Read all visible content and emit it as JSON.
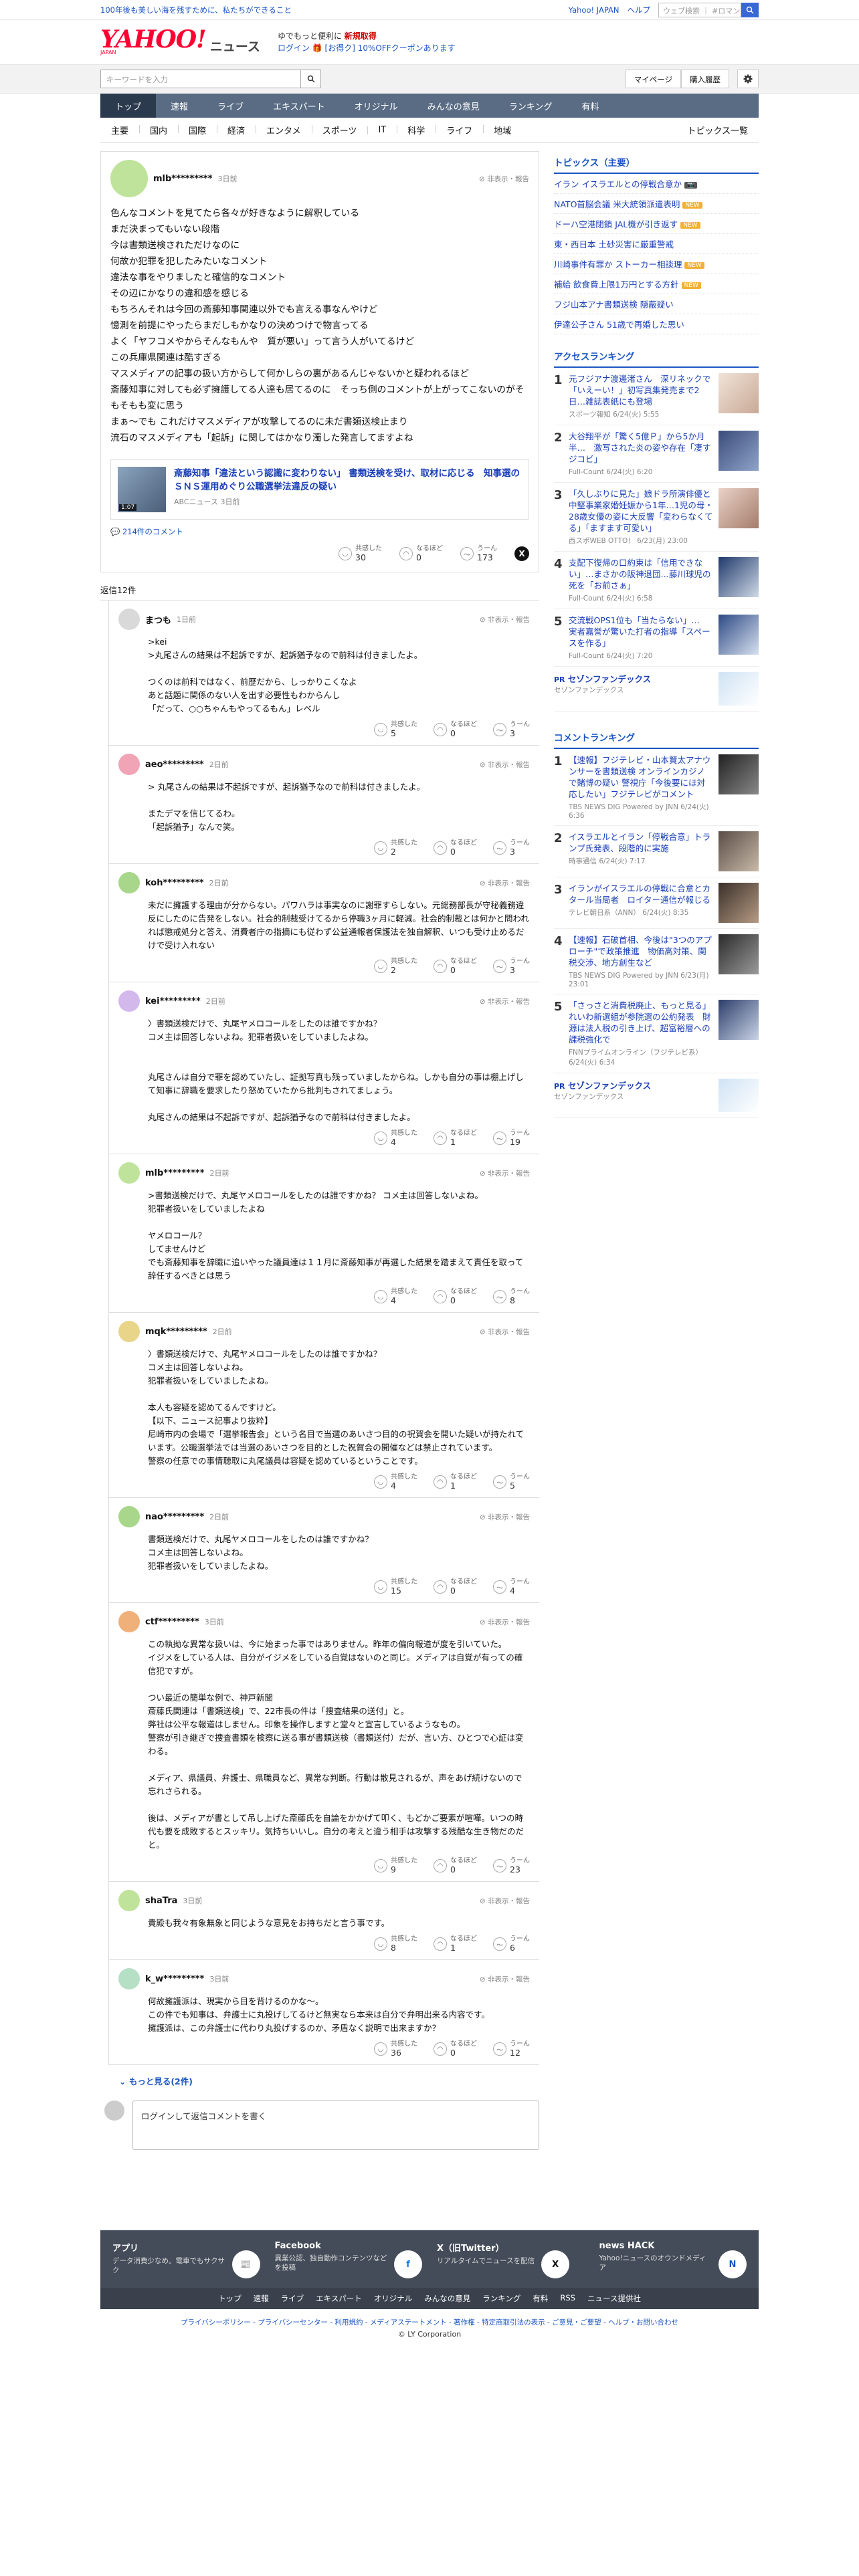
{
  "topstrip": {
    "left": "100年後も美しい海を残すために、私たちができること",
    "yahoo_japan": "Yahoo! JAPAN",
    "help": "ヘルプ",
    "search_placeholder": "ウェブ検索",
    "search_query": "#ロマンティック..."
  },
  "brand": {
    "logo": "YAHOO!",
    "logo_sub": "JAPAN",
    "news": "ニュース",
    "promo1": "ゆでもっと便利に",
    "promo1b": "新規取得",
    "promo2": "ログイン 🎁 [お得ク] 10%OFFクーポンあります"
  },
  "searchbar": {
    "placeholder": "キーワードを入力",
    "mypage": "マイページ",
    "history": "購入履歴"
  },
  "gnav": [
    "トップ",
    "速報",
    "ライブ",
    "エキスパート",
    "オリジナル",
    "みんなの意見",
    "ランキング",
    "有料"
  ],
  "snav": [
    "主要",
    "国内",
    "国際",
    "経済",
    "エンタメ",
    "スポーツ",
    "IT",
    "科学",
    "ライフ",
    "地域"
  ],
  "snav_right": "トピックス一覧",
  "post": {
    "user": "mlb*********",
    "time": "3日前",
    "report": "非表示・報告",
    "text": "色んなコメントを見てたら各々が好きなように解釈している\nまだ決まってもいない段階\n今は書類送検されただけなのに\n何故か犯罪を犯したみたいなコメント\n違法な事をやりましたと確信的なコメント\nその辺にかなりの違和感を感じる\nもちろんそれは今回の斎藤知事関連以外でも言える事なんやけど\n憶測を前提にやったらまだしもかなりの決めつけで物言ってる\nよく「ヤフコメやからそんなもんや　質が悪い」って言う人がいてるけど\nこの兵庫県関連は酷すぎる\nマスメディアの記事の扱い方からして何かしらの裏があるんじゃないかと疑われるほど\n斎藤知事に対しても必ず擁護してる人達も居てるのに　そっち側のコメントが上がってこないのがそもそもも変に思う\nまぁ〜でも これだけマスメディアが攻撃してるのに未だ書類送検止まり\n流石のマスメディアも「起訴」に関してはかなり濁した発言してますよね",
    "article_title": "斎藤知事「違法という認識に変わりない」 書類送検を受け、取材に応じる　知事選のＳＮＳ運用めぐり公職選挙法違反の疑い",
    "article_source": "ABCニュース 3日前",
    "article_duration": "1:07",
    "comment_count": "214件のコメント",
    "reactions": {
      "agree_label": "共感した",
      "agree": "30",
      "naruhodo_label": "なるほど",
      "naruhodo": "0",
      "uun_label": "うーん",
      "uun": "173"
    }
  },
  "reply_header": "返信12件",
  "replies": [
    {
      "user": "まつも",
      "time": "1日前",
      "text": ">kei\n>丸尾さんの結果は不起訴ですが、起訴猶予なので前科は付きましたよ。\n\nつくのは前科ではなく、前歴だから、しっかりこくなよ\nあと話題に関係のない人を出す必要性もわからんし\n「だって、○○ちゃんもやってるもん」レベル",
      "agree": "5",
      "naruhodo": "0",
      "uun": "3",
      "color": "#d9d9d9"
    },
    {
      "user": "aeo*********",
      "time": "2日前",
      "text": "> 丸尾さんの結果は不起訴ですが、起訴猶予なので前科は付きましたよ。\n\nまたデマを信じてるわ。\n「起訴猶予」なんで笑。",
      "agree": "2",
      "naruhodo": "0",
      "uun": "3",
      "color": "#f0a4b5"
    },
    {
      "user": "koh*********",
      "time": "2日前",
      "text": "未だに擁護する理由が分からない。パワハラは事実なのに謝罪すらしない。元総務部長が守秘義務違反にしたのに告発をしない。社会的制裁受けてるから停職3ヶ月に軽減。社会的制裁とは何かと問われれば懲戒処分と答え、消費者庁の指摘にも従わず公益通報者保護法を独自解釈、いつも受け止めるだけで受け入れない",
      "agree": "2",
      "naruhodo": "0",
      "uun": "3",
      "color": "#a8d68a"
    },
    {
      "user": "kei*********",
      "time": "2日前",
      "text": "〉書類送検だけで、丸尾ヤメロコールをしたのは誰ですかね？\nコメ主は回答しないよね。犯罪者扱いをしていましたよね。\n\n\n丸尾さんは自分で罪を認めていたし、証拠写真も残っていましたからね。しかも自分の事は棚上げして知事に辞職を要求したり怒めていたから批判もされてましょう。\n\n丸尾さんの結果は不起訴ですが、起訴猶予なので前科は付きましたよ。",
      "agree": "4",
      "naruhodo": "1",
      "uun": "19",
      "color": "#d3b8ec"
    },
    {
      "user": "mlb*********",
      "time": "2日前",
      "text": ">書類送検だけで、丸尾ヤメロコールをしたのは誰ですかね？ コメ主は回答しないよね。\n犯罪者扱いをしていましたよね\n\nヤメロコール？\nしてませんけど\nでも斎藤知事を辞職に追いやった議員達は１１月に斎藤知事が再選した結果を踏まえて責任を取って辞任するべきとは思う",
      "agree": "4",
      "naruhodo": "0",
      "uun": "8",
      "color": "#bfe39b"
    },
    {
      "user": "mqk*********",
      "time": "2日前",
      "text": "〉書類送検だけで、丸尾ヤメロコールをしたのは誰ですかね？\nコメ主は回答しないよね。\n犯罪者扱いをしていましたよね。\n\n本人も容疑を認めてるんですけど。\n【以下、ニュース記事より抜粋】\n尼崎市内の会場で「選挙報告会」という名目で当選のあいさつ目的の祝賀会を開いた疑いが持たれています。公職選挙法では当選のあいさつを目的とした祝賀会の開催などは禁止されています。\n警察の任意での事情聴取に丸尾議員は容疑を認めているということです。",
      "agree": "4",
      "naruhodo": "1",
      "uun": "5",
      "color": "#e8d58a"
    },
    {
      "user": "nao*********",
      "time": "2日前",
      "text": "書類送検だけで、丸尾ヤメロコールをしたのは誰ですかね？\nコメ主は回答しないよね。\n犯罪者扱いをしていましたよね。",
      "agree": "15",
      "naruhodo": "0",
      "uun": "4",
      "color": "#a8d68a"
    },
    {
      "user": "ctf*********",
      "time": "3日前",
      "text": "この執拗な異常な扱いは、今に始まった事ではありません。昨年の偏向報道が度を引いていた。\nイジメをしている人は、自分がイジメをしている自覚はないのと同じ。メディアは自覚が有っての確信犯ですが。\n\nつい最近の簡単な例で、神戸新聞\n斎藤氏関連は「書類送検」で、22市長の件は「捜査結果の送付」と。\n弊社は公平な報道はしません。印象を操作しますと堂々と宣言しているようなもの。\n警察が引き継ぎで捜査書類を検察に送る事が書類送検（書類送付）だが、言い方、ひとつで心証は変わる。\n\nメディア、県議員、弁護士、県職員など、異常な判断。行動は散見されるが、声をあげ続けないので忘れさられる。\n\n後は、メディアが書として吊し上げた斎藤氏を自論をかかげて叩く、もどかご要素が喧嘩。いつの時代も要を成敗するとスッキリ。気持ちいいし。自分の考えと違う相手は攻撃する残酷な生き物だのだと。",
      "agree": "9",
      "naruhodo": "0",
      "uun": "23",
      "color": "#f0b07a"
    },
    {
      "user": "shaTra",
      "time": "3日前",
      "text": "貴殿も我々有象無象と同じような意見をお持ちだと言う事です。",
      "agree": "8",
      "naruhodo": "1",
      "uun": "6",
      "color": "#bfe39b"
    },
    {
      "user": "k_w*********",
      "time": "3日前",
      "text": "何故擁護派は、現実から目を背けるのかな〜。\nこの件でも知事は、弁護士に丸投げしてるけど無実なら本来は自分で弁明出来る内容です。\n擁護派は、この弁護士に代わり丸投げするのか、矛盾なく説明で出来ますか？",
      "agree": "36",
      "naruhodo": "0",
      "uun": "12",
      "color": "#b5e0c6"
    }
  ],
  "more_replies": "もっと見る(2件)",
  "compose_placeholder": "ログインして返信コメントを書く",
  "sidebar": {
    "topics_title": "トピックス（主要）",
    "topics": [
      {
        "t": "イラン イスラエルとの停戦合意か",
        "badge": "📷"
      },
      {
        "t": "NATO首脳会議 米大統領派遣表明",
        "badge": "NEW"
      },
      {
        "t": "ドーハ空港閉鎖 JAL機が引き返す",
        "badge": "NEW"
      },
      {
        "t": "東・西日本 土砂災害に厳重警戒",
        "badge": ""
      },
      {
        "t": "川崎事件有罪か ストーカー相談理",
        "badge": "NEW"
      },
      {
        "t": "補給 飲食費上限1万円とする方針",
        "badge": "NEW"
      },
      {
        "t": "フジ山本アナ書類送検 隠蔽疑い",
        "badge": ""
      },
      {
        "t": "伊達公子さん 51歳で再婚した思い",
        "badge": ""
      }
    ],
    "access_title": "アクセスランキング",
    "access": [
      {
        "n": "1",
        "t": "元フジアナ渡邊渚さん　深リネックで「いえーい！」初写真集発売まで2日…雑誌表紙にも登場",
        "m": "スポーツ報知 6/24(火) 5:55"
      },
      {
        "n": "2",
        "t": "大谷翔平が「驚く5億Ｐ」から5か月半…　激写された炎の姿や存在「凄すジコビ」",
        "m": "Full-Count 6/24(火) 6:20"
      },
      {
        "n": "3",
        "t": "「久しぶりに見た」娘ドラ所演俳優と中堅事業家婚妊娠から1年…1児の母・28歳女優の姿に大反響「変わらなくてる」「ますます可愛い」",
        "m": "西スポWEB OTTO！ 6/23(月) 23:00"
      },
      {
        "n": "4",
        "t": "支配下復帰の口約束は「信用できない」…まさかの阪神退団…藤川球児の死を「お前さぁ」",
        "m": "Full-Count 6/24(火) 6:58"
      },
      {
        "n": "5",
        "t": "交流戦OPS1位も「当たらない」…　実者嘉誉が驚いた打者の指導「スペースを作る」",
        "m": "Full-Count 6/24(火) 7:20"
      }
    ],
    "ad_title": "セゾンファンデックス",
    "ad_sub": "セゾンファンデックス",
    "comment_title": "コメントランキング",
    "comments": [
      {
        "n": "1",
        "t": "【速報】フジテレビ・山本賢太アナウンサーを書類送検 オンラインカジノで賭博の疑い 警視庁「今後要にほ対応したい」フジテレビがコメント",
        "m": "TBS NEWS DIG Powered by JNN 6/24(火) 6:36"
      },
      {
        "n": "2",
        "t": "イスラエルとイラン「停戦合意」トランプ氏発表、段階的に実施",
        "m": "時事通信 6/24(火) 7:17"
      },
      {
        "n": "3",
        "t": "イランがイスラエルの停戦に合意とカタール当局者　ロイター通信が報じる",
        "m": "テレビ朝日系（ANN） 6/24(火) 8:35"
      },
      {
        "n": "4",
        "t": "【速報】石破首相、今後は\"3つのアプローチ\"で政策推進　物価高対策、関税交渉、地方創生など",
        "m": "TBS NEWS DIG Powered by JNN 6/23(月) 23:01"
      },
      {
        "n": "5",
        "t": "「さっさと消費税廃止、もっと見る」れいわ新選組が参院選の公約発表　財源は法人税の引き上げ、超富裕層への課税強化で",
        "m": "FNNプライムオンライン（フジテレビ系） 6/24(火) 6:34"
      }
    ]
  },
  "footer": {
    "apps": [
      {
        "t": "アプリ",
        "d": "データ消費少なめ。電車でもサクサク"
      },
      {
        "t": "Facebook",
        "d": "異業公認、独自動作コンテンツなどを投稿"
      },
      {
        "t": "X（旧Twitter）",
        "d": "リアルタイムでニュースを配信"
      },
      {
        "t": "news HACK",
        "d": "Yahoo!ニュースのオウンドメディア"
      }
    ],
    "nav": [
      "トップ",
      "速報",
      "ライブ",
      "エキスパート",
      "オリジナル",
      "みんなの意見",
      "ランキング",
      "有料",
      "RSS",
      "ニュース提供社"
    ],
    "links": "プライバシーポリシー - プライバシーセンター - 利用規約 - メディアステートメント - 著作権 - 特定商取引法の表示 - ご意見・ご要望 - ヘルプ・お問い合わせ",
    "copyright": "© LY Corporation"
  }
}
